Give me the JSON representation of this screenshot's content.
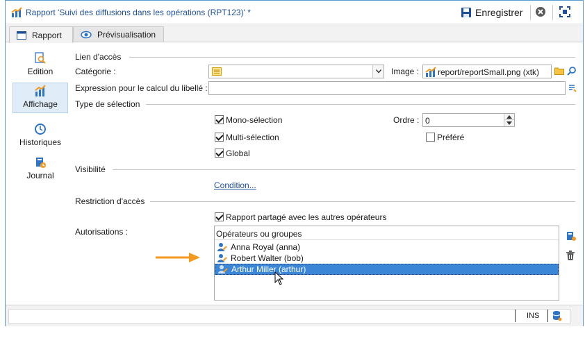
{
  "window": {
    "title_type": "Rapport",
    "title_caption": "'Suivi des diffusions dans les opérations (RPT123)' *",
    "save_label": "Enregistrer"
  },
  "tabs": [
    {
      "label": "Rapport",
      "active": true
    },
    {
      "label": "Prévisualisation",
      "active": false
    }
  ],
  "sidebar": {
    "items": [
      {
        "label": "Edition",
        "icon": "edit-report-icon",
        "active": false
      },
      {
        "label": "Affichage",
        "icon": "chart-icon",
        "active": true
      },
      {
        "label": "Historiques",
        "icon": "clock-icon",
        "active": false
      },
      {
        "label": "Journal",
        "icon": "journal-icon",
        "active": false
      }
    ]
  },
  "form": {
    "access_link_section": "Lien d'accès",
    "category_label": "Catégorie :",
    "category_value": "",
    "image_label": "Image :",
    "image_value": "report/reportSmall.png (xtk)",
    "expression_label": "Expression pour le calcul du libellé :",
    "expression_value": "",
    "selection_type_section": "Type de sélection",
    "mono_selection": {
      "label": "Mono-sélection",
      "checked": true
    },
    "multi_selection": {
      "label": "Multi-sélection",
      "checked": true
    },
    "global": {
      "label": "Global",
      "checked": true
    },
    "order_label": "Ordre :",
    "order_value": "0",
    "preferred": {
      "label": "Préféré",
      "checked": false
    },
    "visibility_section": "Visibilité",
    "condition_link": "Condition...",
    "access_restriction_section": "Restriction d'accès",
    "shared_report": {
      "label": "Rapport partagé avec les autres opérateurs",
      "checked": true
    },
    "authorizations_label": "Autorisations :",
    "operators_header": "Opérateurs ou groupes",
    "operators": [
      {
        "name": "Anna Royal (anna)",
        "selected": false
      },
      {
        "name": "Robert Walter (bob)",
        "selected": false
      },
      {
        "name": "Arthur Miller (arthur)",
        "selected": true
      }
    ]
  },
  "status": {
    "mode": "INS"
  },
  "colors": {
    "accent": "#1f4e9a",
    "selection": "#3b86d6",
    "arrow": "#f39a1e"
  }
}
